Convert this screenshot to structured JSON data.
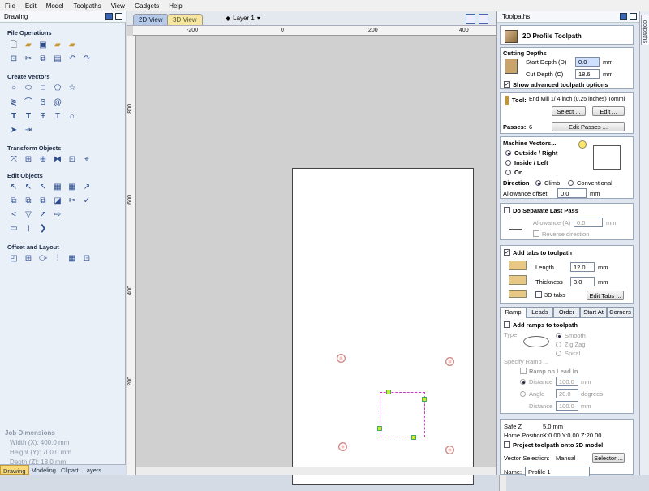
{
  "menu": [
    "File",
    "Edit",
    "Model",
    "Toolpaths",
    "View",
    "Gadgets",
    "Help"
  ],
  "left_panel": {
    "title": "Drawing",
    "sections": [
      "File Operations",
      "Create Vectors",
      "Transform Objects",
      "Edit Objects",
      "Offset and Layout"
    ],
    "job_dimensions": {
      "heading": "Job Dimensions",
      "width": "Width  (X): 400.0 mm",
      "height": "Height (Y): 700.0 mm",
      "depth": "Depth  (Z): 18.0 mm"
    },
    "bottom_tabs": [
      "Drawing",
      "Modeling",
      "Clipart",
      "Layers"
    ]
  },
  "view": {
    "tab_2d": "2D View",
    "tab_3d": "3D View",
    "layer": "Layer 1",
    "ruler_top": [
      "-200",
      "0",
      "200",
      "400"
    ],
    "ruler_left": [
      "800",
      "600",
      "400",
      "200"
    ]
  },
  "toolpaths": {
    "panel_title": "Toolpaths",
    "side_tab": "Toolpaths",
    "header": "2D Profile Toolpath",
    "cutting_depths": {
      "title": "Cutting Depths",
      "start_label": "Start Depth (D)",
      "start_value": "0.0",
      "cut_label": "Cut Depth (C)",
      "cut_value": "18.6",
      "unit": "mm",
      "show_advanced": "Show advanced toolpath options"
    },
    "tool": {
      "label": "Tool:",
      "name": "End Mill 1/ 4 inch (0.25 inches) Tommi",
      "select": "Select ...",
      "edit": "Edit ...",
      "passes_label": "Passes:",
      "passes_value": "6",
      "edit_passes": "Edit Passes ..."
    },
    "machine_vectors": {
      "title": "Machine Vectors...",
      "outside": "Outside / Right",
      "inside": "Inside / Left",
      "on": "On",
      "direction_label": "Direction",
      "climb": "Climb",
      "conventional": "Conventional",
      "allowance_label": "Allowance offset",
      "allowance_value": "0.0",
      "unit": "mm"
    },
    "separate_last_pass": {
      "label": "Do Separate Last Pass",
      "allowance_label": "Allowance (A)",
      "allowance_value": "0.0",
      "unit": "mm",
      "reverse": "Reverse direction"
    },
    "tabs": {
      "label": "Add tabs to toolpath",
      "length_label": "Length",
      "length_value": "12.0",
      "thickness_label": "Thickness",
      "thickness_value": "3.0",
      "unit": "mm",
      "tabs3d": "3D tabs",
      "edit_tabs": "Edit Tabs ..."
    },
    "strategy_tabs": [
      "Ramp",
      "Leads",
      "Order",
      "Start At",
      "Corners"
    ],
    "ramp": {
      "add": "Add ramps to toolpath",
      "type_label": "Type",
      "smooth": "Smooth",
      "zigzag": "Zig Zag",
      "spiral": "Spiral",
      "specify": "Specify Ramp ...",
      "ramp_lead": "Ramp on Lead In",
      "distance_label": "Distance",
      "distance_value": "100.0",
      "angle_label": "Angle",
      "angle_value": "20.0",
      "angle_unit": "degrees",
      "distance2_label": "Distance",
      "distance2_value": "100.0",
      "unit": "mm"
    },
    "footer": {
      "safe_z_label": "Safe Z",
      "safe_z_value": "5.0 mm",
      "home_label": "Home Position",
      "home_value": "X:0.00 Y:0.00 Z:20.00",
      "project": "Project toolpath onto 3D model",
      "vector_sel_label": "Vector Selection:",
      "vector_sel_value": "Manual",
      "selector_btn": "Selector ...",
      "name_label": "Name:",
      "name_value": "Profile 1"
    }
  }
}
